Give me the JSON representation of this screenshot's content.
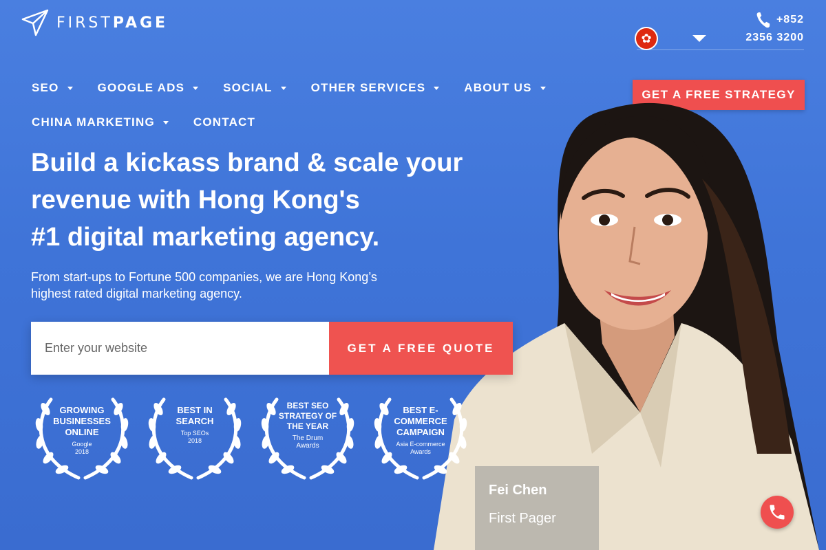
{
  "brand": {
    "name_light": "FIRST",
    "name_bold": "PAGE"
  },
  "header": {
    "phone_code": "+852",
    "phone_number": "2356 3200"
  },
  "nav": {
    "items": [
      {
        "label": "SEO",
        "has_dropdown": true
      },
      {
        "label": "GOOGLE ADS",
        "has_dropdown": true
      },
      {
        "label": "SOCIAL",
        "has_dropdown": true
      },
      {
        "label": "OTHER SERVICES",
        "has_dropdown": true
      },
      {
        "label": "ABOUT US",
        "has_dropdown": true
      },
      {
        "label": "CHINA MARKETING",
        "has_dropdown": true
      },
      {
        "label": "CONTACT",
        "has_dropdown": false
      }
    ],
    "cta_label": "GET A FREE STRATEGY"
  },
  "hero": {
    "title_line1": "Build a kickass brand & scale your",
    "title_line2": "revenue with Hong Kong's",
    "title_line3": "#1 digital marketing agency.",
    "subtitle_line1": "From start-ups to Fortune 500 companies, we are Hong Kong’s",
    "subtitle_line2": "highest rated digital marketing agency.",
    "input_placeholder": "Enter your website",
    "quote_button": "GET A FREE QUOTE"
  },
  "awards": [
    {
      "title": "GROWING BUSINESSES ONLINE",
      "sub1": "Google",
      "sub2": "2018"
    },
    {
      "title": "BEST IN SEARCH",
      "sub1": "Top SEOs",
      "sub2": "2018"
    },
    {
      "title": "BEST SEO STRATEGY OF THE YEAR",
      "sub1": "The Drum",
      "sub2": "Awards"
    },
    {
      "title": "BEST E-COMMERCE CAMPAIGN",
      "sub1": "Asia E-commerce",
      "sub2": "Awards"
    }
  ],
  "person": {
    "name": "Fei Chen",
    "role": "First Pager"
  },
  "colors": {
    "background": "#4479dc",
    "accent": "#ef4f4f"
  }
}
